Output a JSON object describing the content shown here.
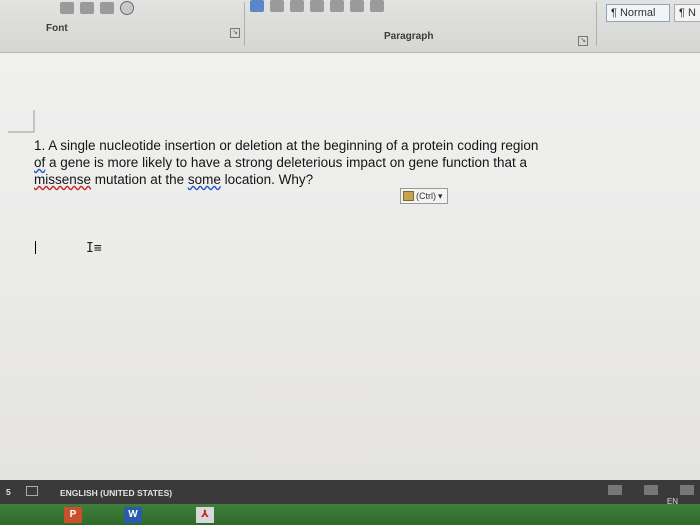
{
  "ribbon": {
    "font_group_label": "Font",
    "paragraph_group_label": "Paragraph",
    "styles": [
      "¶ Normal",
      "¶ N"
    ]
  },
  "document": {
    "lines": [
      "1. A single nucleotide insertion or deletion at the beginning of a protein coding region",
      "of a gene is more likely to have a strong deleterious impact on gene function that a",
      "missense mutation at the some location. Why?"
    ],
    "paste_options_label": "(Ctrl)"
  },
  "status_bar": {
    "page_indicator": "5",
    "language": "ENGLISH (UNITED STATES)",
    "tray_lang": "EN"
  },
  "taskbar": {
    "apps": [
      "P",
      "W"
    ]
  },
  "colors": {
    "accent": "#5b86c8",
    "statusbar": "#3a3a3a",
    "taskbar": "#2f6a2c"
  }
}
